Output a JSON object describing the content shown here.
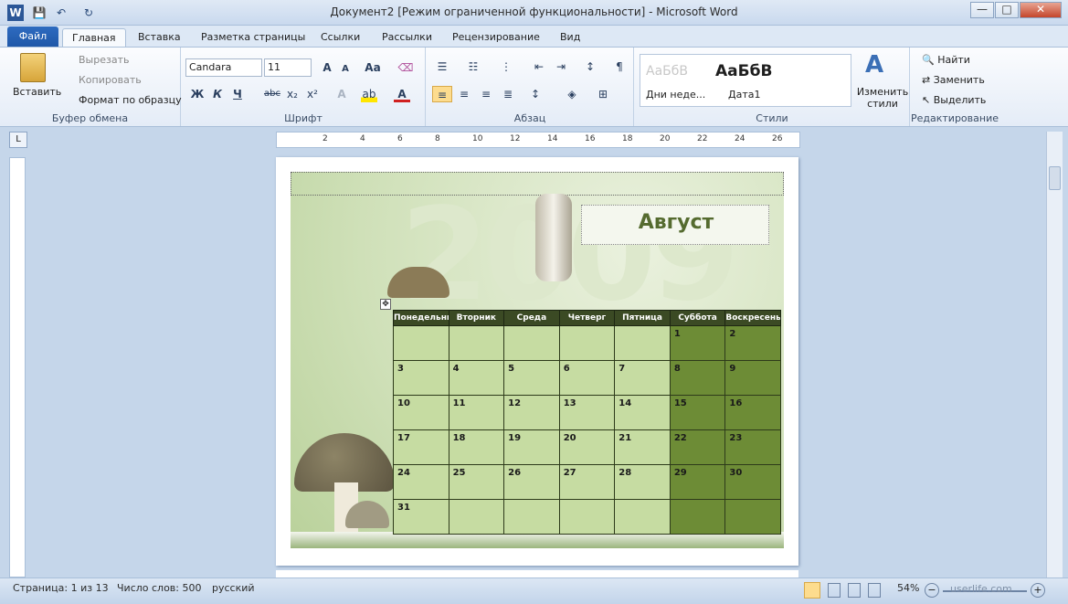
{
  "window": {
    "title": "Документ2 [Режим ограниченной функциональности]  -  Microsoft Word"
  },
  "quick_access": {
    "word_icon": "W",
    "save_icon": "💾",
    "undo_icon": "↶",
    "redo_icon": "↻"
  },
  "window_controls": {
    "minimize": "—",
    "maximize": "□",
    "close": "✕"
  },
  "tabs": [
    {
      "label": "Файл"
    },
    {
      "label": "Главная"
    },
    {
      "label": "Вставка"
    },
    {
      "label": "Разметка страницы"
    },
    {
      "label": "Ссылки"
    },
    {
      "label": "Рассылки"
    },
    {
      "label": "Рецензирование"
    },
    {
      "label": "Вид"
    }
  ],
  "ribbon": {
    "clipboard": {
      "paste": "Вставить",
      "cut": "Вырезать",
      "copy": "Копировать",
      "format_painter": "Формат по образцу",
      "group": "Буфер обмена"
    },
    "font": {
      "name": "Candara",
      "size": "11",
      "group": "Шрифт",
      "bold": "Ж",
      "italic": "К",
      "underline": "Ч",
      "strike": "abc",
      "sub": "x₂",
      "sup": "x²",
      "case": "Aa"
    },
    "paragraph": {
      "group": "Абзац"
    },
    "styles": {
      "group": "Стили",
      "items": [
        {
          "preview": "АаБбВ",
          "label": "Дни неде..."
        },
        {
          "preview": "АаБбВ",
          "label": "Дата1"
        }
      ],
      "change": "Изменить стили"
    },
    "editing": {
      "find": "Найти",
      "replace": "Заменить",
      "select": "Выделить",
      "group": "Редактирование"
    }
  },
  "ruler_numbers": [
    "2",
    "4",
    "6",
    "8",
    "10",
    "12",
    "14",
    "16",
    "18",
    "20",
    "22",
    "24",
    "26"
  ],
  "calendar": {
    "year_watermark": "2009",
    "month": "Август",
    "days": [
      "Понедельник",
      "Вторник",
      "Среда",
      "Четверг",
      "Пятница",
      "Суббота",
      "Воскресенье"
    ],
    "weeks": [
      [
        "",
        "",
        "",
        "",
        "",
        "1",
        "2"
      ],
      [
        "3",
        "4",
        "5",
        "6",
        "7",
        "8",
        "9"
      ],
      [
        "10",
        "11",
        "12",
        "13",
        "14",
        "15",
        "16"
      ],
      [
        "17",
        "18",
        "19",
        "20",
        "21",
        "22",
        "23"
      ],
      [
        "24",
        "25",
        "26",
        "27",
        "28",
        "29",
        "30"
      ],
      [
        "31",
        "",
        "",
        "",
        "",
        "",
        ""
      ]
    ]
  },
  "status": {
    "page": "Страница: 1 из 13",
    "words": "Число слов: 500",
    "lang": "русский",
    "zoom": "54%",
    "watermark": "userlife.com"
  }
}
